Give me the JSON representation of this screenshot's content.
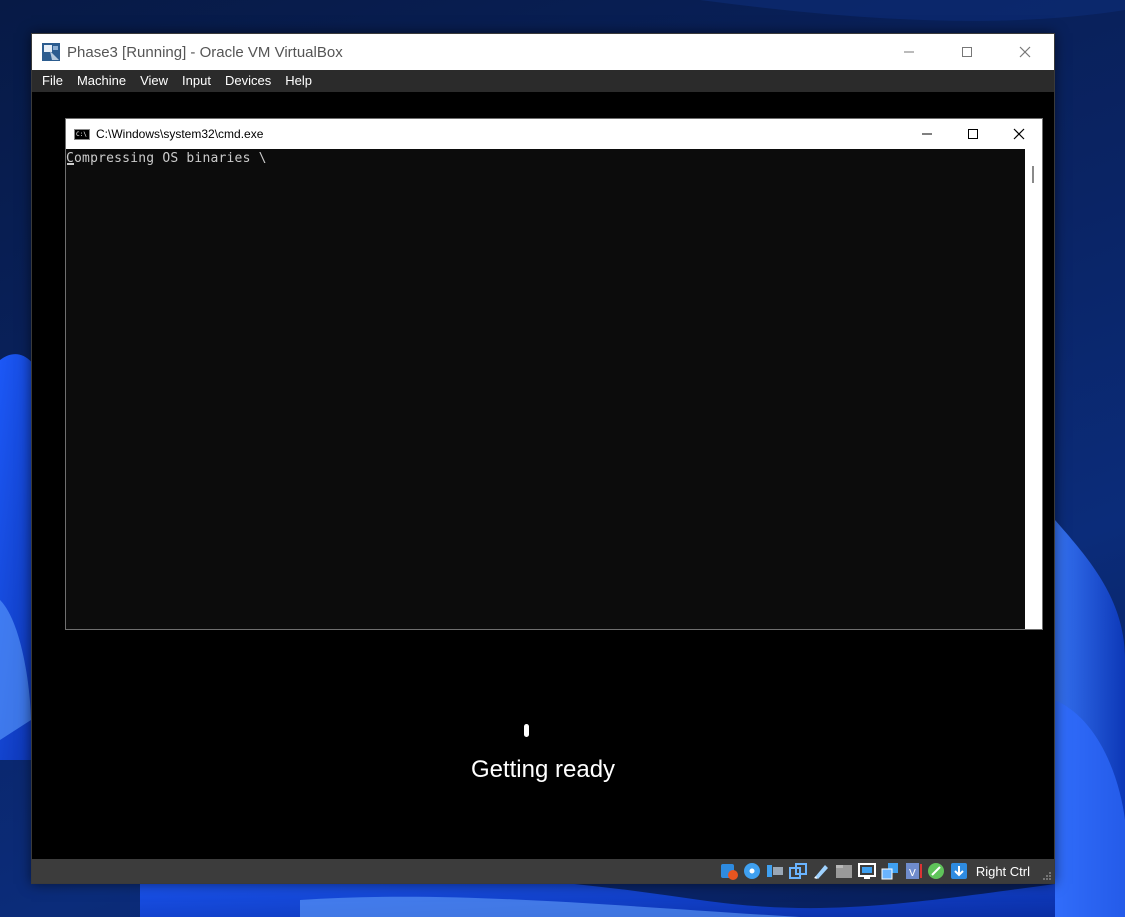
{
  "vbox": {
    "title": "Phase3 [Running] - Oracle VM VirtualBox",
    "menu": [
      "File",
      "Machine",
      "View",
      "Input",
      "Devices",
      "Help"
    ],
    "host_key": "Right Ctrl"
  },
  "cmd": {
    "title": "C:\\Windows\\system32\\cmd.exe",
    "output": "Compressing OS binaries \\"
  },
  "guest": {
    "status": "Getting ready"
  },
  "status_icons": [
    "audio-icon",
    "optical-disk-icon",
    "usb-icon",
    "shared-folders-icon",
    "display-icon",
    "network-icon",
    "recording-icon",
    "mouse-integration-icon",
    "hard-disk-icon",
    "cpu-icon",
    "guest-additions-icon",
    "host-key-icon"
  ]
}
